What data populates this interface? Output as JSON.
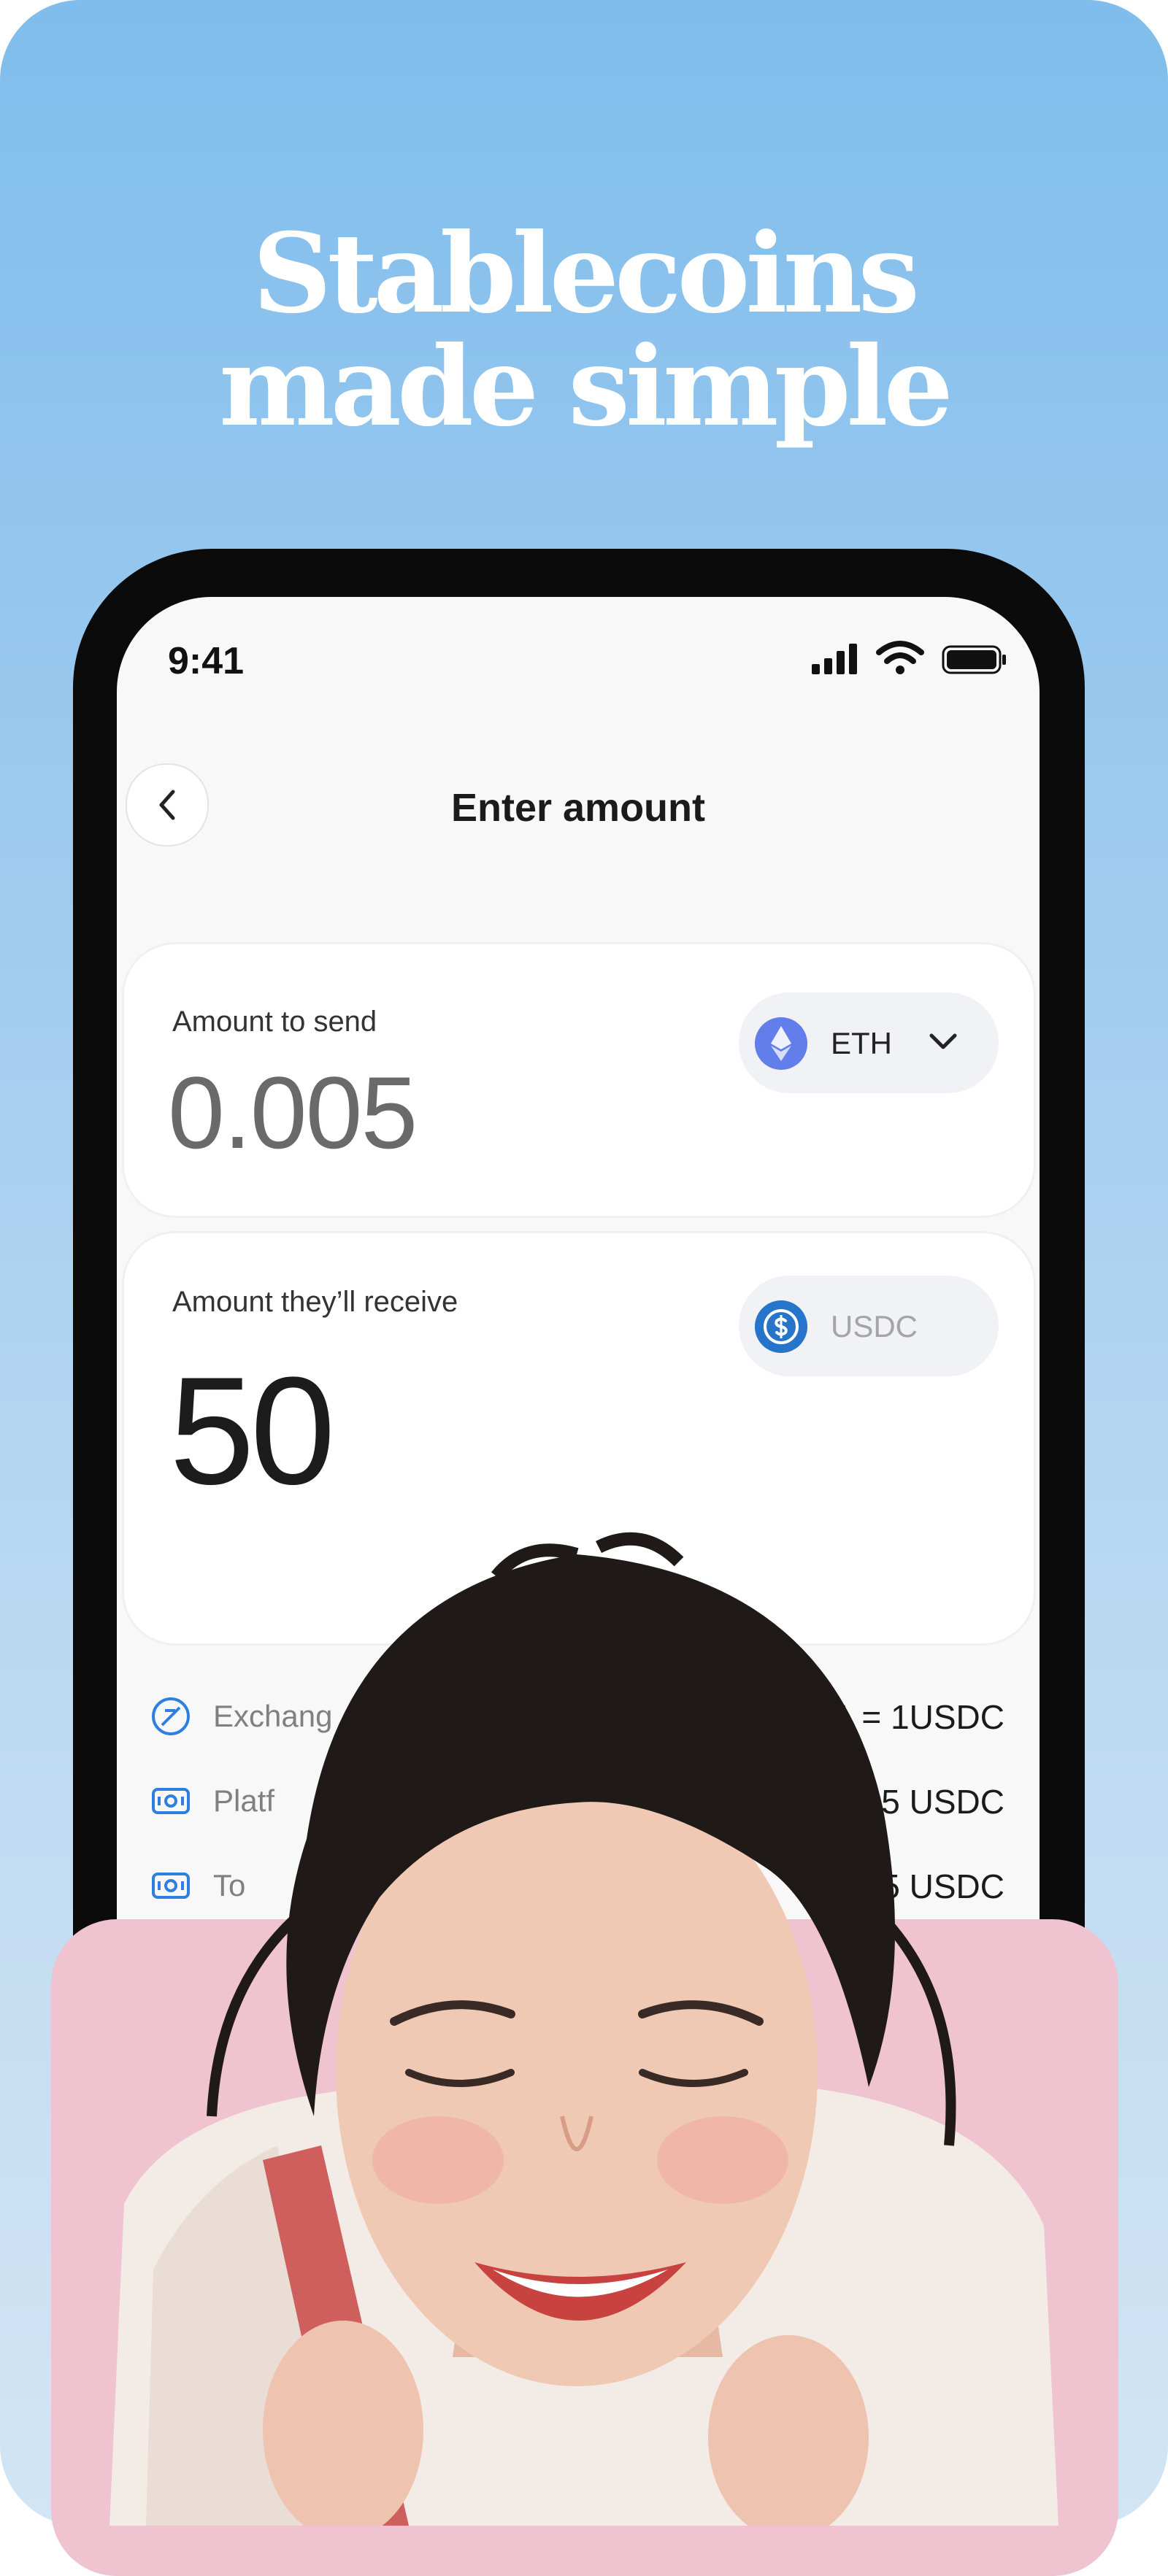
{
  "promo": {
    "headline_line1": "Stablecoins",
    "headline_line2": "made simple"
  },
  "status_bar": {
    "time": "9:41"
  },
  "screen": {
    "title": "Enter amount"
  },
  "send_card": {
    "label": "Amount to send",
    "amount": "0.005",
    "token": "ETH"
  },
  "receive_card": {
    "label": "Amount they’ll receive",
    "amount": "50",
    "token": "USDC"
  },
  "details": [
    {
      "label": "Exchang",
      "value": "$1 = 1USDC",
      "icon": "exchange-icon"
    },
    {
      "label": "Platf",
      "value": "5 USDC",
      "icon": "platform-fee-icon"
    },
    {
      "label": "To",
      "value": "5 USDC",
      "icon": "total-icon"
    }
  ],
  "colors": {
    "background_top": "#80bdec",
    "background_bottom": "#d2e5f4",
    "pink_panel": "#efc3cf",
    "eth": "#627eea",
    "usdc": "#2775ca"
  }
}
